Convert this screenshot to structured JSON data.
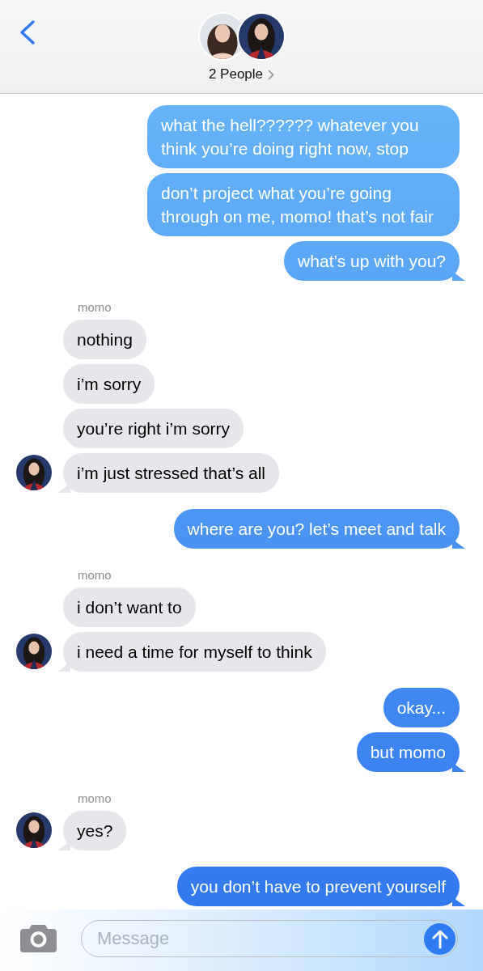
{
  "header": {
    "title": "2 People"
  },
  "conversation": [
    {
      "kind": "sent",
      "messages": [
        "what the hell?????? whatever you think you’re doing right now, stop",
        "don’t project what you’re going through on me, momo! that’s not fair",
        "what’s up with you?"
      ]
    },
    {
      "kind": "received",
      "sender": "momo",
      "messages": [
        "nothing",
        "i’m sorry",
        "you’re right i’m sorry",
        "i’m just stressed that’s all"
      ]
    },
    {
      "kind": "sent",
      "messages": [
        "where are you? let’s meet and talk"
      ]
    },
    {
      "kind": "received",
      "sender": "momo",
      "messages": [
        "i don’t want to",
        "i need a time for myself to think"
      ]
    },
    {
      "kind": "sent",
      "messages": [
        "okay...",
        "but momo"
      ]
    },
    {
      "kind": "received",
      "sender": "momo",
      "messages": [
        "yes?"
      ]
    },
    {
      "kind": "sent",
      "messages": [
        "you don’t have to prevent yourself"
      ]
    }
  ],
  "composer": {
    "placeholder": "Message"
  }
}
